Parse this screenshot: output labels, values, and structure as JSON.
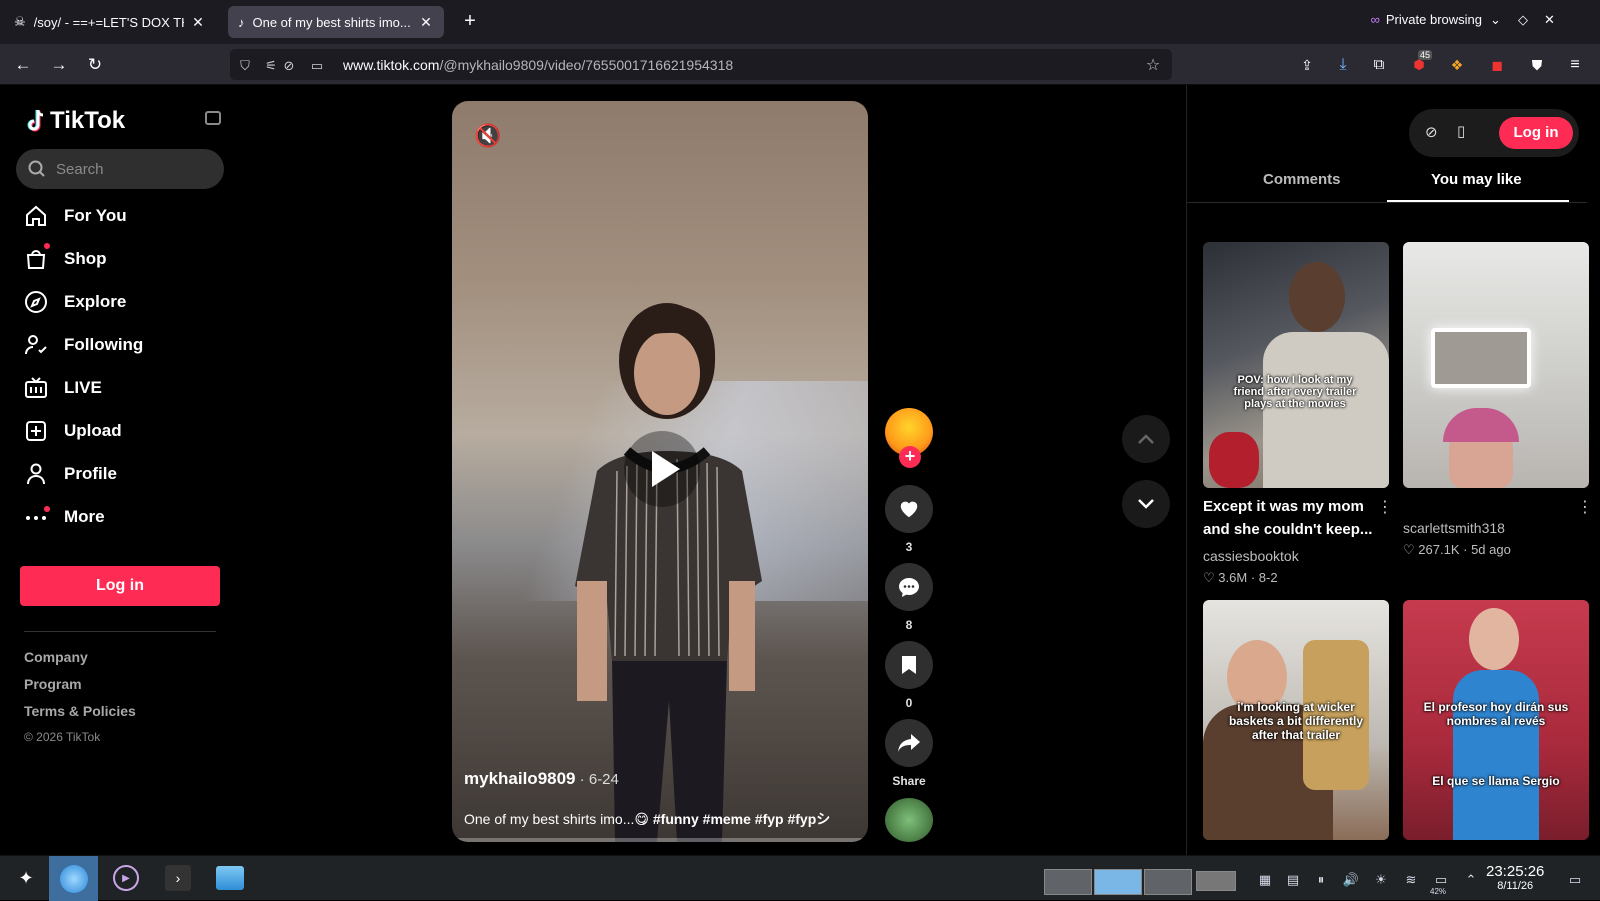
{
  "browser": {
    "tabs": [
      {
        "title": "/soy/ - ==+=LET'S DOX THIS"
      },
      {
        "title": "One of my best shirts imo..."
      }
    ],
    "private_label": "Private browsing",
    "url_host": "www.tiktok.com",
    "url_path": "/@mykhailo9809/video/7655001716621954318",
    "ext_badge": "45"
  },
  "sidebar": {
    "brand": "TikTok",
    "search_placeholder": "Search",
    "items": [
      {
        "label": "For You",
        "icon": "home-icon"
      },
      {
        "label": "Shop",
        "icon": "shop-icon"
      },
      {
        "label": "Explore",
        "icon": "compass-icon"
      },
      {
        "label": "Following",
        "icon": "following-icon"
      },
      {
        "label": "LIVE",
        "icon": "live-icon"
      },
      {
        "label": "Upload",
        "icon": "upload-icon"
      },
      {
        "label": "Profile",
        "icon": "profile-icon"
      },
      {
        "label": "More",
        "icon": "more-icon"
      }
    ],
    "login_label": "Log in",
    "footer": [
      "Company",
      "Program",
      "Terms & Policies"
    ],
    "copyright": "© 2026 TikTok"
  },
  "video": {
    "author": "mykhailo9809",
    "date": " · 6-24",
    "description_text": "One of my best shirts imo...😋 ",
    "hashtags": "#funny #meme #fyp #fypシ"
  },
  "actions": {
    "likes": "3",
    "comments": "8",
    "saves": "0",
    "share_label": "Share"
  },
  "right_panel": {
    "login_label": "Log in",
    "tabs": [
      "Comments",
      "You may like"
    ],
    "active_tab": "You may like",
    "videos": [
      {
        "title_line1": "Except it was my mom",
        "title_line2": "and she couldn't keep...",
        "author": "cassiesbooktok",
        "likes": "3.6M",
        "date": "8-2",
        "overlay": "POV: how I look at my friend after every trailer plays at the movies"
      },
      {
        "title_line1": "",
        "title_line2": "",
        "author": "scarlettsmith318",
        "likes": "267.1K",
        "date": "5d ago",
        "overlay": ""
      },
      {
        "overlay": "i'm looking at wicker baskets a bit differently after that trailer"
      },
      {
        "overlay_a": "El profesor hoy dirán sus nombres al revés",
        "overlay_b": "El que se llama Sergio"
      }
    ]
  },
  "taskbar": {
    "time": "23:25:26",
    "date": "8/11/26",
    "battery": "42%"
  }
}
